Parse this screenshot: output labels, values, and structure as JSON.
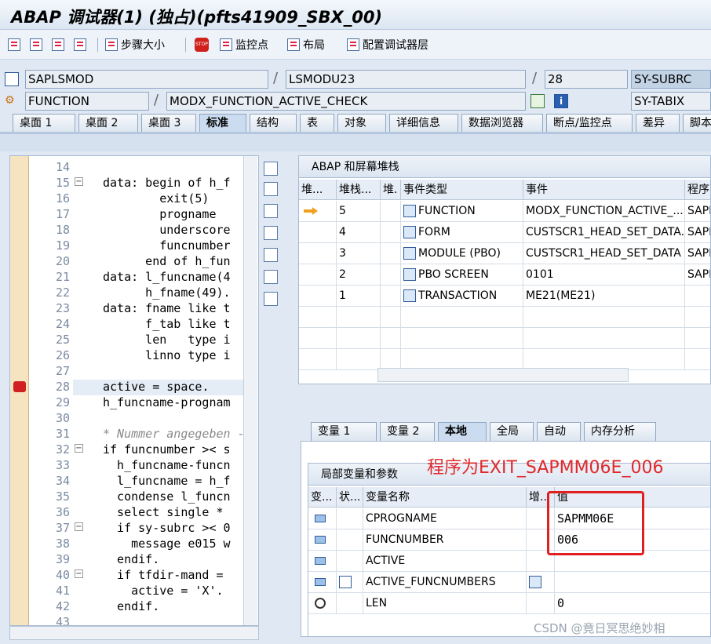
{
  "window": {
    "title": "ABAP 调试器(1) (独占)(pfts41909_SBX_00)"
  },
  "toolbar": {
    "step_size": "步骤大小",
    "breakpoints": "监控点",
    "layout": "布局",
    "configure": "配置调试器层"
  },
  "context": {
    "program": "SAPLSMOD",
    "include": "LSMODU23",
    "line": "28",
    "field1": "SY-SUBRC",
    "event_type": "FUNCTION",
    "event": "MODX_FUNCTION_ACTIVE_CHECK",
    "field2": "SY-TABIX"
  },
  "tabs": [
    "桌面 1",
    "桌面 2",
    "桌面 3",
    "标准",
    "结构",
    "表",
    "对象",
    "详细信息",
    "数据浏览器",
    "断点/监控点",
    "差异",
    "脚本"
  ],
  "code": {
    "lines": [
      {
        "n": "14",
        "text": ""
      },
      {
        "n": "15",
        "text": "data: begin of h_f"
      },
      {
        "n": "16",
        "text": "        exit(5)"
      },
      {
        "n": "17",
        "text": "        progname"
      },
      {
        "n": "18",
        "text": "        underscore"
      },
      {
        "n": "19",
        "text": "        funcnumber"
      },
      {
        "n": "20",
        "text": "      end of h_fun"
      },
      {
        "n": "21",
        "text": "data: l_funcname(4"
      },
      {
        "n": "22",
        "text": "      h_fname(49)."
      },
      {
        "n": "23",
        "text": "data: fname like t"
      },
      {
        "n": "24",
        "text": "      f_tab like t"
      },
      {
        "n": "25",
        "text": "      len   type i"
      },
      {
        "n": "26",
        "text": "      linno type i"
      },
      {
        "n": "27",
        "text": ""
      },
      {
        "n": "28",
        "text": "active = space."
      },
      {
        "n": "29",
        "text": "h_funcname-prognam"
      },
      {
        "n": "30",
        "text": ""
      },
      {
        "n": "31",
        "text": "* Nummer angegeben -"
      },
      {
        "n": "32",
        "text": "if funcnumber >< s"
      },
      {
        "n": "33",
        "text": "  h_funcname-funcn"
      },
      {
        "n": "34",
        "text": "  l_funcname = h_f"
      },
      {
        "n": "35",
        "text": "  condense l_funcn"
      },
      {
        "n": "36",
        "text": "  select single *"
      },
      {
        "n": "37",
        "text": "  if sy-subrc >< 0"
      },
      {
        "n": "38",
        "text": "    message e015 w"
      },
      {
        "n": "39",
        "text": "  endif."
      },
      {
        "n": "40",
        "text": "  if tfdir-mand ="
      },
      {
        "n": "41",
        "text": "    active = 'X'."
      },
      {
        "n": "42",
        "text": "  endif."
      },
      {
        "n": "43",
        "text": ""
      }
    ]
  },
  "stack": {
    "title": "ABAP 和屏幕堆栈",
    "headers": [
      "堆...",
      "堆栈...",
      "堆.",
      "事件类型",
      "事件",
      "程序"
    ],
    "rows": [
      {
        "level": "5",
        "type": "FUNCTION",
        "event": "MODX_FUNCTION_ACTIVE_...",
        "prog": "SAPL"
      },
      {
        "level": "4",
        "type": "FORM",
        "event": "CUSTSCR1_HEAD_SET_DATA...",
        "prog": "SAPM"
      },
      {
        "level": "3",
        "type": "MODULE (PBO)",
        "event": "CUSTSCR1_HEAD_SET_DATA",
        "prog": "SAPM"
      },
      {
        "level": "2",
        "type": "PBO SCREEN",
        "event": "0101",
        "prog": "SAPM"
      },
      {
        "level": "1",
        "type": "TRANSACTION",
        "event": "ME21(ME21)",
        "prog": ""
      }
    ]
  },
  "var_tabs": [
    "变量 1",
    "变量 2",
    "本地",
    "全局",
    "自动",
    "内存分析"
  ],
  "vars": {
    "title": "局部变量和参数",
    "headers": [
      "变...",
      "状...",
      "变量名称",
      "增...",
      "值"
    ],
    "rows": [
      {
        "name": "CPROGNAME",
        "value": "SAPMM06E"
      },
      {
        "name": "FUNCNUMBER",
        "value": "006"
      },
      {
        "name": "ACTIVE",
        "value": ""
      },
      {
        "name": "ACTIVE_FUNCNUMBERS",
        "value": ""
      },
      {
        "name": "LEN",
        "value": "0"
      }
    ]
  },
  "annotation": "程序为EXIT_SAPMM06E_006",
  "watermark": "CSDN @竟日冥思绝妙相",
  "colors": {
    "annotation": "#e0282a",
    "breakpoint": "#d02020"
  }
}
